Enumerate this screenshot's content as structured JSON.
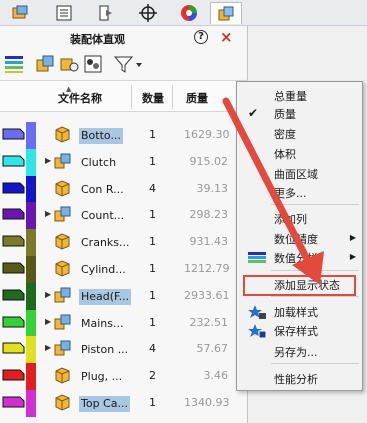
{
  "tabs": [
    {
      "icon": "feature-manager-icon"
    },
    {
      "icon": "property-manager-icon"
    },
    {
      "icon": "configuration-manager-icon"
    },
    {
      "icon": "dimxpert-icon"
    },
    {
      "icon": "display-manager-icon"
    },
    {
      "icon": "assembly-visualization-icon",
      "selected": true
    }
  ],
  "panel": {
    "title": "装配体直观",
    "help": "?",
    "close": "×"
  },
  "columns": {
    "name": "文件名称",
    "qty": "数量",
    "mass": "质量"
  },
  "rows": [
    {
      "name": "Botto...",
      "qty": "1",
      "mass": "1629.30",
      "color": "#6c6cf0",
      "highlight": true,
      "expand": false,
      "icon": "part-icon"
    },
    {
      "name": "Clutch",
      "qty": "1",
      "mass": "915.02",
      "color": "#2fe6e6",
      "highlight": false,
      "expand": true,
      "icon": "subassembly-icon"
    },
    {
      "name": "Con R...",
      "qty": "4",
      "mass": "39.13",
      "color": "#1515c8",
      "highlight": false,
      "expand": false,
      "icon": "part-icon"
    },
    {
      "name": "Count...",
      "qty": "1",
      "mass": "298.23",
      "color": "#6818b0",
      "highlight": false,
      "expand": true,
      "icon": "subassembly-icon"
    },
    {
      "name": "Cranks...",
      "qty": "1",
      "mass": "931.43",
      "color": "#7a7a28",
      "highlight": false,
      "expand": false,
      "icon": "part-icon"
    },
    {
      "name": "Cylind...",
      "qty": "1",
      "mass": "1212.79",
      "color": "#5a5a18",
      "highlight": false,
      "expand": false,
      "icon": "part-icon"
    },
    {
      "name": "Head(F...",
      "qty": "1",
      "mass": "2933.61",
      "color": "#1e6b1e",
      "highlight": true,
      "expand": true,
      "icon": "subassembly-icon"
    },
    {
      "name": "Mains...",
      "qty": "1",
      "mass": "232.51",
      "color": "#38d038",
      "highlight": false,
      "expand": true,
      "icon": "subassembly-icon"
    },
    {
      "name": "Piston ...",
      "qty": "4",
      "mass": "57.67",
      "color": "#e0e020",
      "highlight": false,
      "expand": true,
      "icon": "subassembly-icon"
    },
    {
      "name": "Plug, ...",
      "qty": "2",
      "mass": "3.46",
      "color": "#e02020",
      "highlight": false,
      "expand": false,
      "icon": "part-icon"
    },
    {
      "name": "Top Ca...",
      "qty": "1",
      "mass": "1340.93",
      "color": "#d030d0",
      "highlight": true,
      "expand": false,
      "icon": "part-icon"
    }
  ],
  "menu": {
    "items": [
      {
        "label": "总重量",
        "checked": false,
        "submenu": false
      },
      {
        "label": "质量",
        "checked": true,
        "submenu": false
      },
      {
        "label": "密度",
        "checked": false,
        "submenu": false
      },
      {
        "label": "体积",
        "checked": false,
        "submenu": false
      },
      {
        "label": "曲面区域",
        "checked": false,
        "submenu": false
      },
      {
        "label": "更多...",
        "checked": false,
        "submenu": false
      },
      {
        "label": "添加列",
        "checked": false,
        "submenu": false
      },
      {
        "label": "数位精度",
        "checked": false,
        "submenu": true
      },
      {
        "label": "数值分栏",
        "checked": false,
        "submenu": true
      },
      {
        "label": "添加显示状态",
        "checked": false,
        "submenu": false
      },
      {
        "label": "加载样式",
        "checked": false,
        "submenu": false
      },
      {
        "label": "保存样式",
        "checked": false,
        "submenu": false
      },
      {
        "label": "另存为...",
        "checked": false,
        "submenu": false
      },
      {
        "label": "性能分析",
        "checked": false,
        "submenu": false
      }
    ],
    "highlight_label": "添加显示状态"
  },
  "colors": {
    "accent_red": "#e24a3e",
    "selection": "#a9c6e3"
  }
}
